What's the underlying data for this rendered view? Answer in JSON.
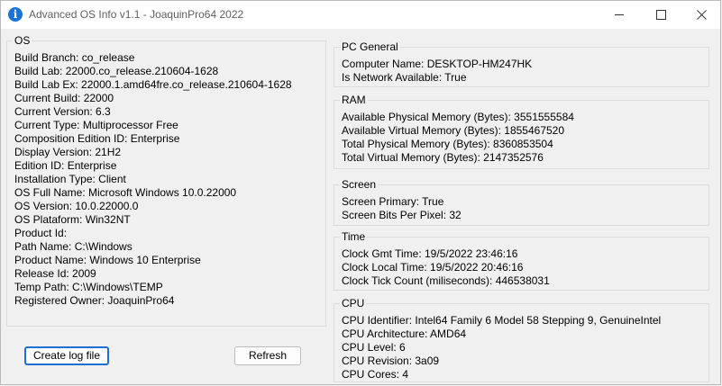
{
  "window": {
    "title": "Advanced OS Info v1.1 - JoaquinPro64 2022",
    "icon": "info-icon",
    "controls": {
      "minimize": "minimize-icon",
      "maximize": "maximize-icon",
      "close": "close-icon"
    }
  },
  "os": {
    "title": "OS",
    "lines": [
      "Build Branch: co_release",
      "Build Lab: 22000.co_release.210604-1628",
      "Build Lab Ex: 22000.1.amd64fre.co_release.210604-1628",
      "Current Build: 22000",
      "Current Version: 6.3",
      "Current Type: Multiprocessor Free",
      "Composition Edition ID: Enterprise",
      "Display Version: 21H2",
      "Edition ID: Enterprise",
      "Installation Type: Client",
      "OS Full Name: Microsoft Windows 10.0.22000",
      "OS Version: 10.0.22000.0",
      "OS Plataform: Win32NT",
      "Product Id:",
      "Path Name: C:\\Windows",
      "Product Name: Windows 10 Enterprise",
      "Release Id: 2009",
      "Temp Path: C:\\Windows\\TEMP",
      "Registered Owner: JoaquinPro64"
    ]
  },
  "pc_general": {
    "title": "PC General",
    "lines": [
      "Computer Name: DESKTOP-HM247HK",
      "Is Network Available: True"
    ]
  },
  "ram": {
    "title": "RAM",
    "lines": [
      "Available Physical Memory (Bytes): 3551555584",
      "Available Virtual Memory (Bytes): 1855467520",
      "Total Physical Memory (Bytes):  8360853504",
      "Total Virtual Memory (Bytes):  2147352576"
    ]
  },
  "screen": {
    "title": "Screen",
    "lines": [
      "Screen Primary:  True",
      "Screen Bits Per Pixel:  32"
    ]
  },
  "time": {
    "title": "Time",
    "lines": [
      "Clock Gmt Time: 19/5/2022 23:46:16",
      "Clock Local Time: 19/5/2022 20:46:16",
      "Clock Tick Count (miliseconds): 446538031"
    ]
  },
  "cpu": {
    "title": "CPU",
    "lines": [
      "CPU Identifier: Intel64 Family 6 Model 58 Stepping 9, GenuineIntel",
      "CPU Architecture: AMD64",
      "CPU Level: 6",
      "CPU Revision: 3a09",
      "CPU Cores: 4"
    ]
  },
  "buttons": {
    "create_log": "Create log file",
    "refresh": "Refresh"
  }
}
